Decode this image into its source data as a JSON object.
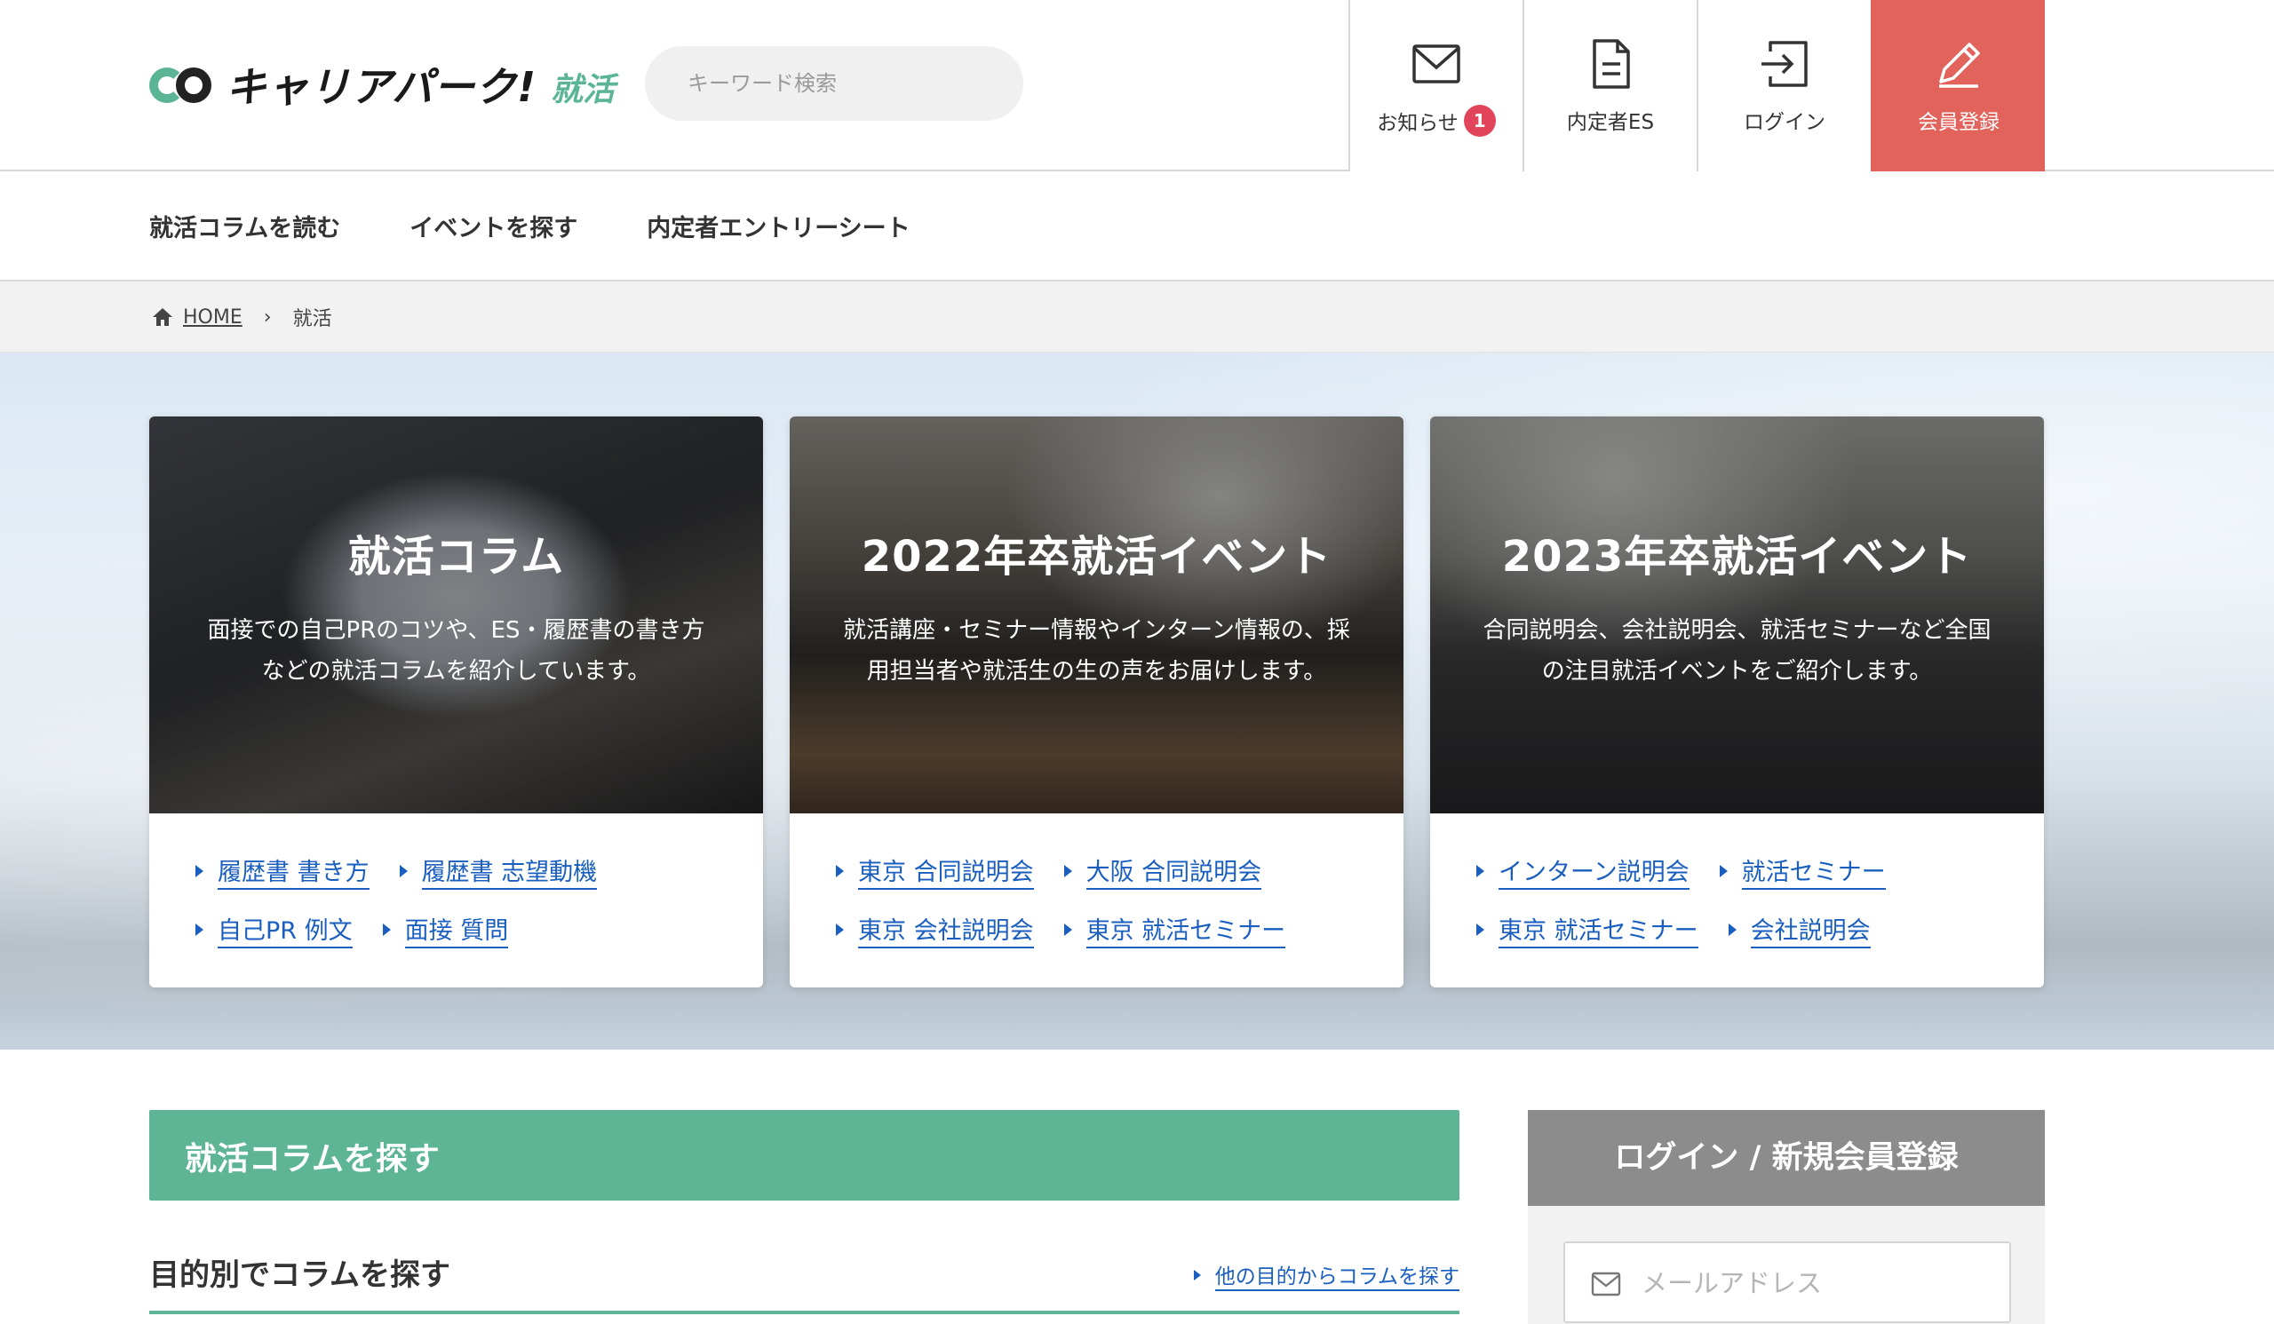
{
  "header": {
    "logo_text": "キャリアパーク!",
    "logo_sub": "就活",
    "search_placeholder": "キーワード検索",
    "nav": {
      "news_label": "お知らせ",
      "news_badge": "1",
      "es_label": "内定者ES",
      "login_label": "ログイン",
      "register_label": "会員登録"
    }
  },
  "global_nav": [
    "就活コラムを読む",
    "イベントを探す",
    "内定者エントリーシート"
  ],
  "breadcrumb": {
    "home": "HOME",
    "sep": "›",
    "current": "就活"
  },
  "cards": [
    {
      "title": "就活コラム",
      "desc_lines": [
        "面接での自己PRのコツや、ES・履歴書の書き方",
        "などの就活コラムを紹介しています。"
      ],
      "links": [
        [
          "履歴書 書き方",
          "履歴書 志望動機"
        ],
        [
          "自己PR 例文",
          "面接 質問"
        ]
      ]
    },
    {
      "title": "2022年卒就活イベント",
      "desc_lines": [
        "就活講座・セミナー情報やインターン情報の、採",
        "用担当者や就活生の生の声をお届けします。"
      ],
      "links": [
        [
          "東京 合同説明会",
          "大阪 合同説明会"
        ],
        [
          "東京 会社説明会",
          "東京 就活セミナー"
        ]
      ]
    },
    {
      "title": "2023年卒就活イベント",
      "desc_lines": [
        "合同説明会、会社説明会、就活セミナーなど全国",
        "の注目就活イベントをご紹介します。"
      ],
      "links": [
        [
          "インターン説明会",
          "就活セミナー"
        ],
        [
          "東京 就活セミナー",
          "会社説明会"
        ]
      ]
    }
  ],
  "main": {
    "section_title": "就活コラムを探す",
    "purpose_title": "目的別でコラムを探す",
    "purpose_more": "他の目的からコラムを探す"
  },
  "login": {
    "title": "ログイン / 新規会員登録",
    "email_placeholder": "メールアドレス"
  },
  "colors": {
    "brand_green": "#5db596",
    "register_red": "#e2635b",
    "link_blue": "#1a5fbf",
    "badge_red": "#e2455a"
  },
  "icons": [
    "search-icon",
    "mail-icon",
    "document-icon",
    "login-icon",
    "pencil-icon",
    "home-icon"
  ]
}
